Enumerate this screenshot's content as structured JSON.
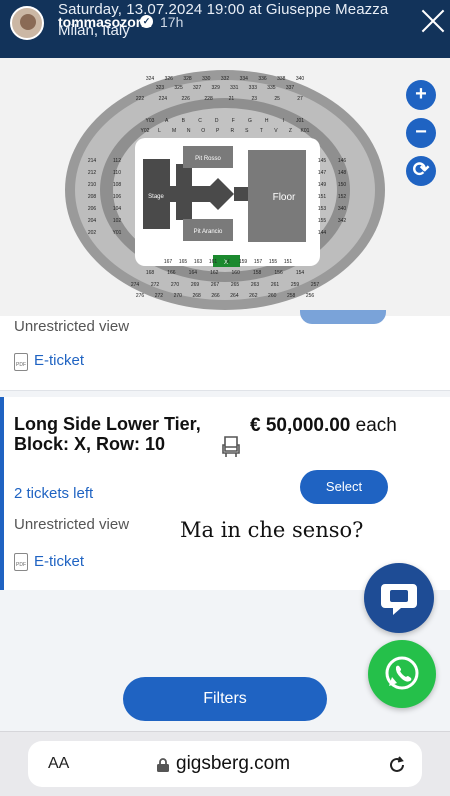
{
  "story": {
    "event_line": "Saturday, 13.07.2024 19:00 at Giuseppe Meazza",
    "username": "tommasozorzi",
    "time_ago": "17h",
    "location": "Milan, Italy"
  },
  "map": {
    "zoom_in": "+",
    "zoom_out": "−",
    "reset": "⟳",
    "labels": {
      "stage": "Stage",
      "floor": "Floor",
      "pit_rosso": "Pit Rosso",
      "pit_arancio": "Pit Arancio",
      "block_x": "X",
      "top_rows": [
        "324",
        "326",
        "328",
        "330",
        "332",
        "334",
        "336",
        "338",
        "340"
      ],
      "second_rows": [
        "323",
        "325",
        "327",
        "329",
        "331",
        "333",
        "335",
        "337"
      ],
      "inner_rows": [
        "222",
        "224",
        "226",
        "228",
        "21",
        "23",
        "25",
        "27"
      ],
      "letters_top": [
        "Y03",
        "A",
        "B",
        "C",
        "D",
        "F",
        "G",
        "H",
        "I",
        "J01"
      ],
      "letters_bottom": [
        "Y02",
        "L",
        "M",
        "N",
        "O",
        "P",
        "R",
        "S",
        "T",
        "V",
        "Z",
        "K01"
      ],
      "left_blocks": [
        "214",
        "212",
        "210",
        "208",
        "206",
        "204",
        "202",
        "112",
        "110",
        "108",
        "106",
        "104",
        "102",
        "Y01"
      ],
      "right_blocks": [
        "145",
        "147",
        "149",
        "151",
        "153",
        "155",
        "144",
        "146",
        "148",
        "150",
        "152",
        "340",
        "342"
      ],
      "bottom_inner": [
        "167",
        "165",
        "163",
        "161",
        "X",
        "159",
        "157",
        "155",
        "151"
      ],
      "bottom_mid": [
        "168",
        "166",
        "164",
        "162",
        "160",
        "158",
        "156",
        "154"
      ],
      "bottom_outer": [
        "274",
        "272",
        "270",
        "269",
        "267",
        "265",
        "263",
        "261",
        "259",
        "257"
      ],
      "bottom_outer2": [
        "276",
        "272",
        "270",
        "268",
        "266",
        "264",
        "262",
        "260",
        "258",
        "256"
      ]
    }
  },
  "listing_prev": {
    "view": "Unrestricted view",
    "eticket": "E-ticket"
  },
  "listing": {
    "title": "Long Side Lower Tier, Block: X, Row: 10",
    "price": "€ 50,000.00",
    "price_unit": "each",
    "tickets_left": "2 tickets left",
    "select": "Select",
    "view": "Unrestricted view",
    "eticket": "E-ticket"
  },
  "caption": "Ma in che senso?",
  "filters": "Filters",
  "browser": {
    "text_size": "AA",
    "url": "gigsberg.com"
  },
  "colors": {
    "accent": "#1f63c2",
    "header": "#12335a",
    "whatsapp": "#25c04a",
    "chat": "#1e4c95"
  }
}
